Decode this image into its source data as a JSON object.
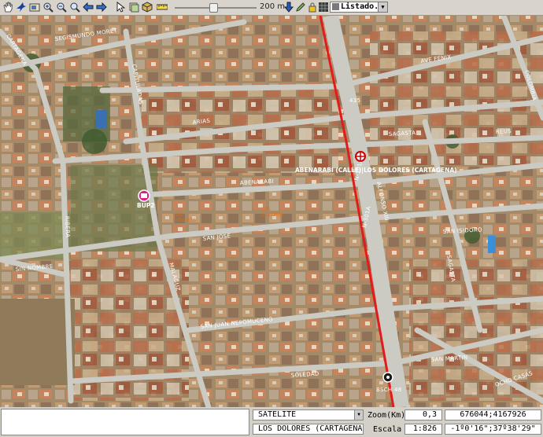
{
  "toolbar": {
    "tools": [
      "hand-icon",
      "bird-icon",
      "photo-icon",
      "zoom-in-icon",
      "zoom-out-icon",
      "zoom-search-icon",
      "back-arrow-icon",
      "forward-arrow-icon",
      "cursor-icon",
      "layers-icon",
      "cube-icon",
      "ruler-icon"
    ],
    "scale_label": "200 m",
    "slider_position": 0.48,
    "tools_right": [
      "download-arrow-icon",
      "pencil-icon",
      "lock-icon",
      "grid-icon"
    ],
    "list_label": "Listado..."
  },
  "map": {
    "street_labels": [
      "SEGISMUNDO MORET",
      "CAPITULADAS",
      "AVE FENIX",
      "COLOMBIA",
      "ARIAS",
      "SAGASTA",
      "REUS",
      "ABENARABI",
      "SAN JOSE",
      "SAN ISIDORO",
      "SIN NOMBRE",
      "RIBERA",
      "MALAGUZ",
      "SAN JUAN NEPOMUCENO",
      "SAN MARTIN",
      "SOLEDAD",
      "OCHO CASAS",
      "CARTAGENA",
      "SAGASTA"
    ],
    "road_refs": [
      "N-301A",
      "N-301A",
      "ALFONSO XIII",
      "435"
    ],
    "crosshair_label": "ABENARABI (CALLE)|LOS DOLORES (CARTAGENA)",
    "pois": [
      {
        "icon": "bus-stop-icon",
        "label": "BUP2"
      },
      {
        "icon": "pin-icon",
        "label": "BSCH 48"
      }
    ],
    "poi_text": [
      "LOS\nDOLORES",
      "LOS\nDOLORES"
    ],
    "route_color": "#e21b1b"
  },
  "status": {
    "layer_value": "SATELITE",
    "zoom_label": "Zoom(Km)",
    "zoom_value": "0,3",
    "utm_coords": "676044;4167926",
    "location_value": "LOS DOLORES (CARTAGENA)",
    "scale_label": "Escala",
    "scale_value": "1:826",
    "geo_coords": "-1º0'16\";37º38'29\""
  }
}
